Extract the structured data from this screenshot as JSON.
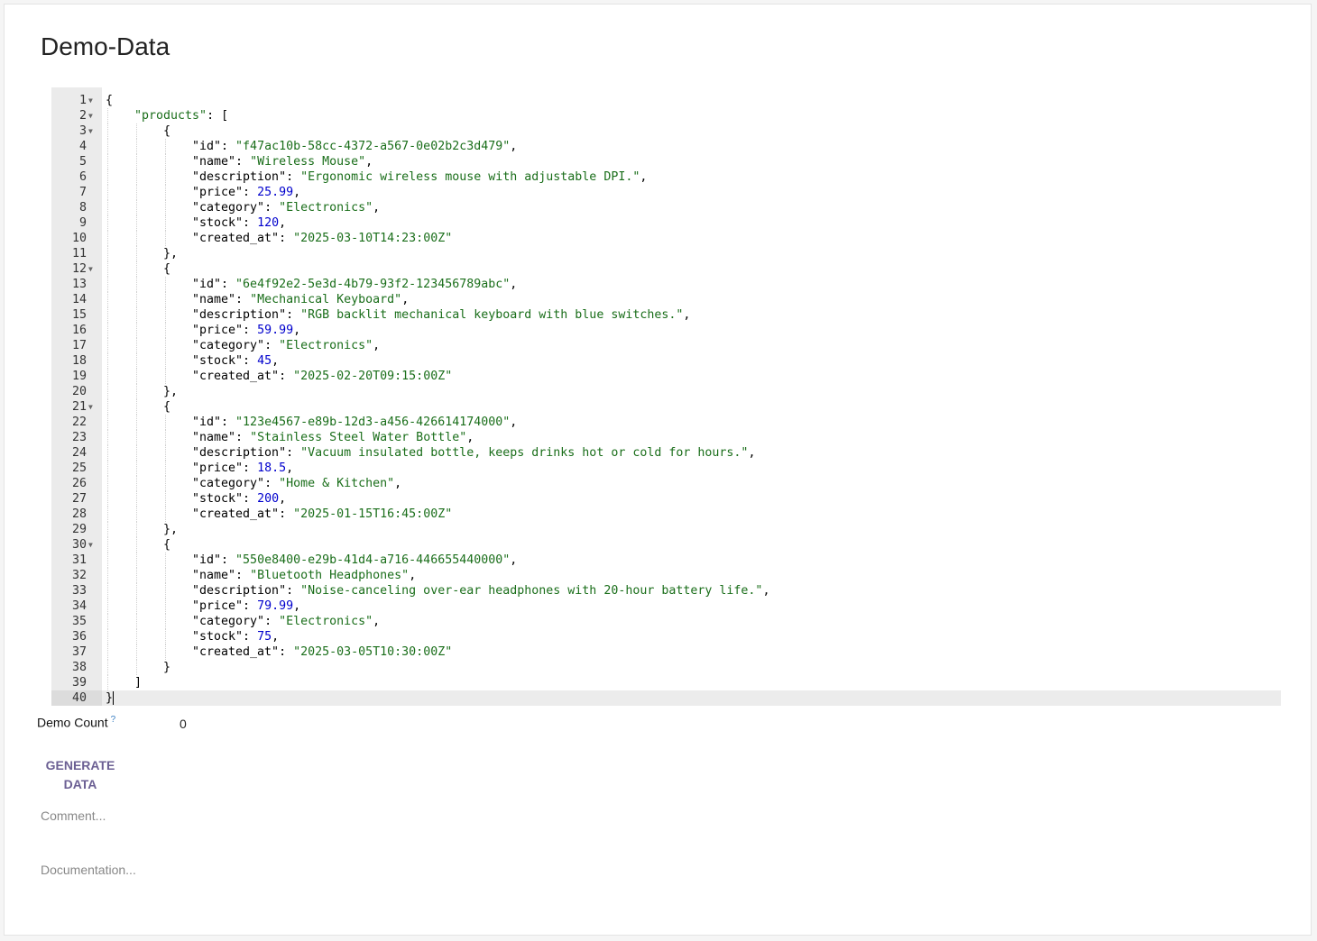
{
  "page": {
    "title": "Demo-Data"
  },
  "editor": {
    "active_line": 40,
    "lines": [
      {
        "n": 1,
        "fold": true,
        "indent": 0,
        "tokens": [
          [
            "p",
            "{"
          ]
        ]
      },
      {
        "n": 2,
        "fold": true,
        "indent": 1,
        "tokens": [
          [
            "s",
            "\"products\""
          ],
          [
            "p",
            ": ["
          ]
        ]
      },
      {
        "n": 3,
        "fold": true,
        "indent": 2,
        "tokens": [
          [
            "p",
            "{"
          ]
        ]
      },
      {
        "n": 4,
        "fold": false,
        "indent": 3,
        "tokens": [
          [
            "k",
            "\"id\""
          ],
          [
            "p",
            ": "
          ],
          [
            "s",
            "\"f47ac10b-58cc-4372-a567-0e02b2c3d479\""
          ],
          [
            "p",
            ","
          ]
        ]
      },
      {
        "n": 5,
        "fold": false,
        "indent": 3,
        "tokens": [
          [
            "k",
            "\"name\""
          ],
          [
            "p",
            ": "
          ],
          [
            "s",
            "\"Wireless Mouse\""
          ],
          [
            "p",
            ","
          ]
        ]
      },
      {
        "n": 6,
        "fold": false,
        "indent": 3,
        "tokens": [
          [
            "k",
            "\"description\""
          ],
          [
            "p",
            ": "
          ],
          [
            "s",
            "\"Ergonomic wireless mouse with adjustable DPI.\""
          ],
          [
            "p",
            ","
          ]
        ]
      },
      {
        "n": 7,
        "fold": false,
        "indent": 3,
        "tokens": [
          [
            "k",
            "\"price\""
          ],
          [
            "p",
            ": "
          ],
          [
            "n",
            "25.99"
          ],
          [
            "p",
            ","
          ]
        ]
      },
      {
        "n": 8,
        "fold": false,
        "indent": 3,
        "tokens": [
          [
            "k",
            "\"category\""
          ],
          [
            "p",
            ": "
          ],
          [
            "s",
            "\"Electronics\""
          ],
          [
            "p",
            ","
          ]
        ]
      },
      {
        "n": 9,
        "fold": false,
        "indent": 3,
        "tokens": [
          [
            "k",
            "\"stock\""
          ],
          [
            "p",
            ": "
          ],
          [
            "n",
            "120"
          ],
          [
            "p",
            ","
          ]
        ]
      },
      {
        "n": 10,
        "fold": false,
        "indent": 3,
        "tokens": [
          [
            "k",
            "\"created_at\""
          ],
          [
            "p",
            ": "
          ],
          [
            "s",
            "\"2025-03-10T14:23:00Z\""
          ]
        ]
      },
      {
        "n": 11,
        "fold": false,
        "indent": 2,
        "tokens": [
          [
            "p",
            "},"
          ]
        ]
      },
      {
        "n": 12,
        "fold": true,
        "indent": 2,
        "tokens": [
          [
            "p",
            "{"
          ]
        ]
      },
      {
        "n": 13,
        "fold": false,
        "indent": 3,
        "tokens": [
          [
            "k",
            "\"id\""
          ],
          [
            "p",
            ": "
          ],
          [
            "s",
            "\"6e4f92e2-5e3d-4b79-93f2-123456789abc\""
          ],
          [
            "p",
            ","
          ]
        ]
      },
      {
        "n": 14,
        "fold": false,
        "indent": 3,
        "tokens": [
          [
            "k",
            "\"name\""
          ],
          [
            "p",
            ": "
          ],
          [
            "s",
            "\"Mechanical Keyboard\""
          ],
          [
            "p",
            ","
          ]
        ]
      },
      {
        "n": 15,
        "fold": false,
        "indent": 3,
        "tokens": [
          [
            "k",
            "\"description\""
          ],
          [
            "p",
            ": "
          ],
          [
            "s",
            "\"RGB backlit mechanical keyboard with blue switches.\""
          ],
          [
            "p",
            ","
          ]
        ]
      },
      {
        "n": 16,
        "fold": false,
        "indent": 3,
        "tokens": [
          [
            "k",
            "\"price\""
          ],
          [
            "p",
            ": "
          ],
          [
            "n",
            "59.99"
          ],
          [
            "p",
            ","
          ]
        ]
      },
      {
        "n": 17,
        "fold": false,
        "indent": 3,
        "tokens": [
          [
            "k",
            "\"category\""
          ],
          [
            "p",
            ": "
          ],
          [
            "s",
            "\"Electronics\""
          ],
          [
            "p",
            ","
          ]
        ]
      },
      {
        "n": 18,
        "fold": false,
        "indent": 3,
        "tokens": [
          [
            "k",
            "\"stock\""
          ],
          [
            "p",
            ": "
          ],
          [
            "n",
            "45"
          ],
          [
            "p",
            ","
          ]
        ]
      },
      {
        "n": 19,
        "fold": false,
        "indent": 3,
        "tokens": [
          [
            "k",
            "\"created_at\""
          ],
          [
            "p",
            ": "
          ],
          [
            "s",
            "\"2025-02-20T09:15:00Z\""
          ]
        ]
      },
      {
        "n": 20,
        "fold": false,
        "indent": 2,
        "tokens": [
          [
            "p",
            "},"
          ]
        ]
      },
      {
        "n": 21,
        "fold": true,
        "indent": 2,
        "tokens": [
          [
            "p",
            "{"
          ]
        ]
      },
      {
        "n": 22,
        "fold": false,
        "indent": 3,
        "tokens": [
          [
            "k",
            "\"id\""
          ],
          [
            "p",
            ": "
          ],
          [
            "s",
            "\"123e4567-e89b-12d3-a456-426614174000\""
          ],
          [
            "p",
            ","
          ]
        ]
      },
      {
        "n": 23,
        "fold": false,
        "indent": 3,
        "tokens": [
          [
            "k",
            "\"name\""
          ],
          [
            "p",
            ": "
          ],
          [
            "s",
            "\"Stainless Steel Water Bottle\""
          ],
          [
            "p",
            ","
          ]
        ]
      },
      {
        "n": 24,
        "fold": false,
        "indent": 3,
        "tokens": [
          [
            "k",
            "\"description\""
          ],
          [
            "p",
            ": "
          ],
          [
            "s",
            "\"Vacuum insulated bottle, keeps drinks hot or cold for hours.\""
          ],
          [
            "p",
            ","
          ]
        ]
      },
      {
        "n": 25,
        "fold": false,
        "indent": 3,
        "tokens": [
          [
            "k",
            "\"price\""
          ],
          [
            "p",
            ": "
          ],
          [
            "n",
            "18.5"
          ],
          [
            "p",
            ","
          ]
        ]
      },
      {
        "n": 26,
        "fold": false,
        "indent": 3,
        "tokens": [
          [
            "k",
            "\"category\""
          ],
          [
            "p",
            ": "
          ],
          [
            "s",
            "\"Home & Kitchen\""
          ],
          [
            "p",
            ","
          ]
        ]
      },
      {
        "n": 27,
        "fold": false,
        "indent": 3,
        "tokens": [
          [
            "k",
            "\"stock\""
          ],
          [
            "p",
            ": "
          ],
          [
            "n",
            "200"
          ],
          [
            "p",
            ","
          ]
        ]
      },
      {
        "n": 28,
        "fold": false,
        "indent": 3,
        "tokens": [
          [
            "k",
            "\"created_at\""
          ],
          [
            "p",
            ": "
          ],
          [
            "s",
            "\"2025-01-15T16:45:00Z\""
          ]
        ]
      },
      {
        "n": 29,
        "fold": false,
        "indent": 2,
        "tokens": [
          [
            "p",
            "},"
          ]
        ]
      },
      {
        "n": 30,
        "fold": true,
        "indent": 2,
        "tokens": [
          [
            "p",
            "{"
          ]
        ]
      },
      {
        "n": 31,
        "fold": false,
        "indent": 3,
        "tokens": [
          [
            "k",
            "\"id\""
          ],
          [
            "p",
            ": "
          ],
          [
            "s",
            "\"550e8400-e29b-41d4-a716-446655440000\""
          ],
          [
            "p",
            ","
          ]
        ]
      },
      {
        "n": 32,
        "fold": false,
        "indent": 3,
        "tokens": [
          [
            "k",
            "\"name\""
          ],
          [
            "p",
            ": "
          ],
          [
            "s",
            "\"Bluetooth Headphones\""
          ],
          [
            "p",
            ","
          ]
        ]
      },
      {
        "n": 33,
        "fold": false,
        "indent": 3,
        "tokens": [
          [
            "k",
            "\"description\""
          ],
          [
            "p",
            ": "
          ],
          [
            "s",
            "\"Noise-canceling over-ear headphones with 20-hour battery life.\""
          ],
          [
            "p",
            ","
          ]
        ]
      },
      {
        "n": 34,
        "fold": false,
        "indent": 3,
        "tokens": [
          [
            "k",
            "\"price\""
          ],
          [
            "p",
            ": "
          ],
          [
            "n",
            "79.99"
          ],
          [
            "p",
            ","
          ]
        ]
      },
      {
        "n": 35,
        "fold": false,
        "indent": 3,
        "tokens": [
          [
            "k",
            "\"category\""
          ],
          [
            "p",
            ": "
          ],
          [
            "s",
            "\"Electronics\""
          ],
          [
            "p",
            ","
          ]
        ]
      },
      {
        "n": 36,
        "fold": false,
        "indent": 3,
        "tokens": [
          [
            "k",
            "\"stock\""
          ],
          [
            "p",
            ": "
          ],
          [
            "n",
            "75"
          ],
          [
            "p",
            ","
          ]
        ]
      },
      {
        "n": 37,
        "fold": false,
        "indent": 3,
        "tokens": [
          [
            "k",
            "\"created_at\""
          ],
          [
            "p",
            ": "
          ],
          [
            "s",
            "\"2025-03-05T10:30:00Z\""
          ]
        ]
      },
      {
        "n": 38,
        "fold": false,
        "indent": 2,
        "tokens": [
          [
            "p",
            "}"
          ]
        ]
      },
      {
        "n": 39,
        "fold": false,
        "indent": 1,
        "tokens": [
          [
            "p",
            "]"
          ]
        ]
      },
      {
        "n": 40,
        "fold": false,
        "indent": 0,
        "tokens": [
          [
            "p",
            "}"
          ]
        ]
      }
    ]
  },
  "demo_count": {
    "label": "Demo Count",
    "help": "?",
    "value": "0"
  },
  "generate_button": {
    "label": "GENERATE DATA"
  },
  "comment": {
    "placeholder": "Comment..."
  },
  "documentation": {
    "placeholder": "Documentation..."
  },
  "colors": {
    "string": "#1a6e1a",
    "number": "#0000cd",
    "button": "#6b5f93"
  }
}
